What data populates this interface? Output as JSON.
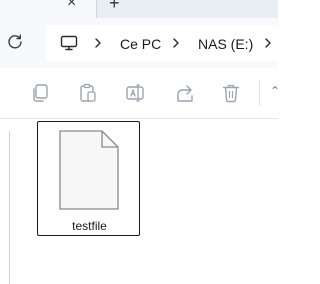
{
  "tabs": {
    "close_glyph": "×",
    "new_tab_glyph": "+"
  },
  "address": {
    "icon": "computer-icon",
    "crumbs": [
      "Ce PC",
      "NAS (E:)"
    ]
  },
  "toolbar": {
    "icons": [
      "copy-icon",
      "paste-icon",
      "rename-icon",
      "share-icon",
      "delete-icon"
    ],
    "more_glyph": "⌃"
  },
  "files": [
    {
      "name": "testfile",
      "icon": "document-icon"
    }
  ],
  "colors": {
    "tabbar": "#e9eef5",
    "header": "#f7f9fc",
    "disabled_icon": "#9aa4b2"
  }
}
